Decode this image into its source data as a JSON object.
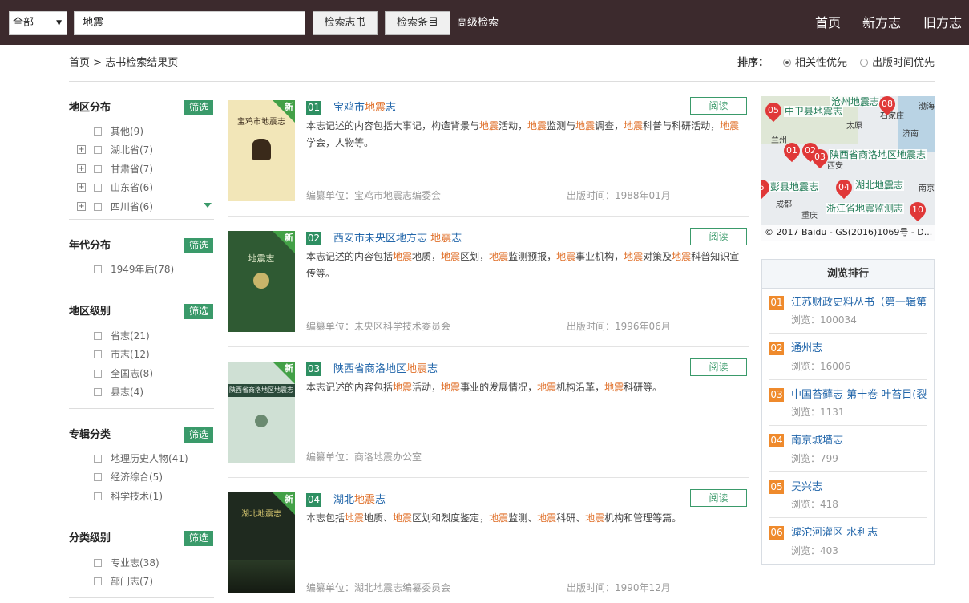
{
  "topbar": {
    "scope_value": "全部",
    "keyword_value": "地震",
    "search_books": "检索志书",
    "search_entries": "检索条目",
    "advanced": "高级检索",
    "nav": [
      "首页",
      "新方志",
      "旧方志"
    ]
  },
  "breadcrumb": {
    "home": "首页",
    "sep": ">",
    "current": "志书检索结果页"
  },
  "sort": {
    "label": "排序：",
    "options": [
      "相关性优先",
      "出版时间优先"
    ],
    "selected": "相关性优先"
  },
  "filter_button": "筛选",
  "filters": [
    {
      "title": "地区分布",
      "items": [
        "其他(9)",
        "湖北省(7)",
        "甘肃省(7)",
        "山东省(6)",
        "四川省(6)"
      ]
    },
    {
      "title": "年代分布",
      "items": [
        "1949年后(78)"
      ]
    },
    {
      "title": "地区级别",
      "items": [
        "省志(21)",
        "市志(12)",
        "全国志(8)",
        "县志(4)"
      ]
    },
    {
      "title": "专辑分类",
      "items": [
        "地理历史人物(41)",
        "经济综合(5)",
        "科学技术(1)"
      ]
    },
    {
      "title": "分类级别",
      "items": [
        "专业志(38)",
        "部门志(7)"
      ]
    }
  ],
  "results": {
    "new_tag": "新",
    "read_label": "阅读",
    "editor_prefix": "编纂单位：",
    "date_prefix": "出版时间：",
    "items": [
      {
        "num": "01",
        "title_pre": "宝鸡市",
        "title_hl": "地震",
        "title_post": "志",
        "cover_text": "宝鸡市地震志",
        "desc": [
          [
            "本志记述的内容包括大事记，构造背景与",
            0
          ],
          [
            "地震",
            1
          ],
          [
            "活动，",
            0
          ],
          [
            "地震",
            1
          ],
          [
            "监测与",
            0
          ],
          [
            "地震",
            1
          ],
          [
            "调查，",
            0
          ],
          [
            "地震",
            1
          ],
          [
            "科普与科研活动，",
            0
          ],
          [
            "地震",
            1
          ],
          [
            "学会，人物等。",
            0
          ]
        ],
        "editor": "宝鸡市地震志编委会",
        "date": "1988年01月"
      },
      {
        "num": "02",
        "title_pre": "西安市未央区地方志 ",
        "title_hl": "地震",
        "title_post": "志",
        "cover_text": "地震志",
        "desc": [
          [
            "本志记述的内容包括",
            0
          ],
          [
            "地震",
            1
          ],
          [
            "地质，",
            0
          ],
          [
            "地震",
            1
          ],
          [
            "区划，",
            0
          ],
          [
            "地震",
            1
          ],
          [
            "监测预报，",
            0
          ],
          [
            "地震",
            1
          ],
          [
            "事业机构，",
            0
          ],
          [
            "地震",
            1
          ],
          [
            "对策及",
            0
          ],
          [
            "地震",
            1
          ],
          [
            "科普知识宣传等。",
            0
          ]
        ],
        "editor": "未央区科学技术委员会",
        "date": "1996年06月"
      },
      {
        "num": "03",
        "title_pre": "陕西省商洛地区",
        "title_hl": "地震",
        "title_post": "志",
        "cover_text": "陕西省商洛地区地震志",
        "desc": [
          [
            "本志记述的内容包括",
            0
          ],
          [
            "地震",
            1
          ],
          [
            "活动，",
            0
          ],
          [
            "地震",
            1
          ],
          [
            "事业的发展情况，",
            0
          ],
          [
            "地震",
            1
          ],
          [
            "机构沿革，",
            0
          ],
          [
            "地震",
            1
          ],
          [
            "科研等。",
            0
          ]
        ],
        "editor": "商洛地震办公室",
        "date": ""
      },
      {
        "num": "04",
        "title_pre": "湖北",
        "title_hl": "地震",
        "title_post": "志",
        "cover_text": "湖北地震志",
        "desc": [
          [
            "本志包括",
            0
          ],
          [
            "地震",
            1
          ],
          [
            "地质、",
            0
          ],
          [
            "地震",
            1
          ],
          [
            "区划和烈度鉴定，",
            0
          ],
          [
            "地震",
            1
          ],
          [
            "监测、",
            0
          ],
          [
            "地震",
            1
          ],
          [
            "科研、",
            0
          ],
          [
            "地震",
            1
          ],
          [
            "机构和管理等篇。",
            0
          ]
        ],
        "editor": "湖北地震志编纂委员会",
        "date": "1990年12月"
      }
    ]
  },
  "map": {
    "labels": [
      "中卫县地震志",
      "沧州地震志",
      "陕西省商洛地区地震志",
      "彭县地震志",
      "湖北地震志",
      "浙江省地震监测志"
    ],
    "cities": [
      "太原",
      "石家庄",
      "济南",
      "渤海",
      "兰州",
      "西安",
      "成都",
      "重庆",
      "南京"
    ],
    "pins": [
      "05",
      "08",
      "01",
      "02",
      "03",
      "6",
      "04",
      "10"
    ],
    "copyright": "© 2017 Baidu - GS(2016)1069号 - D..."
  },
  "ranking": {
    "title": "浏览排行",
    "view_prefix": "浏览：",
    "items": [
      {
        "num": "01",
        "title": "江苏财政史料丛书（第一辑第",
        "views": "100034"
      },
      {
        "num": "02",
        "title": "通州志",
        "views": "16006"
      },
      {
        "num": "03",
        "title": "中国苔藓志 第十卷 叶苔目(裂",
        "views": "1131"
      },
      {
        "num": "04",
        "title": "南京城墙志",
        "views": "799"
      },
      {
        "num": "05",
        "title": "吴兴志",
        "views": "418"
      },
      {
        "num": "06",
        "title": "滹沱河灌区 水利志",
        "views": "403"
      }
    ]
  },
  "colors": {
    "topbar": "#3c2a2d",
    "accent_green": "#3a9a6a",
    "highlight": "#e0702a",
    "link": "#2266aa",
    "rank_badge": "#ef8a2c"
  }
}
